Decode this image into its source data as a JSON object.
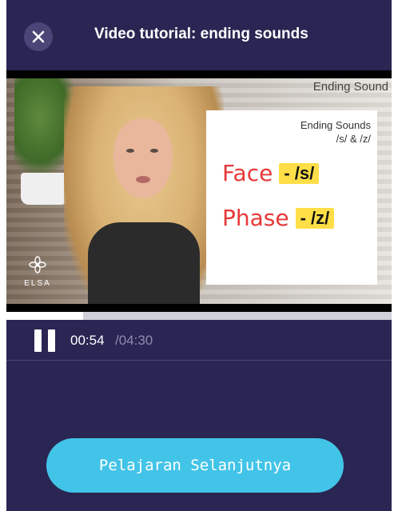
{
  "header": {
    "title": "Video tutorial: ending sounds",
    "close_icon": "close-icon"
  },
  "video": {
    "corner_label": "Ending Sound",
    "logo_text": "ELSA",
    "slide": {
      "heading_line1": "Ending Sounds",
      "heading_line2": "/s/ & /z/",
      "rows": [
        {
          "word": "Face",
          "tag": "- /s/"
        },
        {
          "word": "Phase",
          "tag": "- /z/"
        }
      ]
    }
  },
  "player": {
    "current_time": "00:54",
    "total_time": "/04:30",
    "progress_fraction": 0.2,
    "pause_icon": "pause-icon"
  },
  "footer": {
    "next_label": "Pelajaran Selanjutnya"
  },
  "colors": {
    "background": "#2a2653",
    "accent": "#42c4e8",
    "highlight": "#ffde47",
    "word_red": "#e73838"
  }
}
